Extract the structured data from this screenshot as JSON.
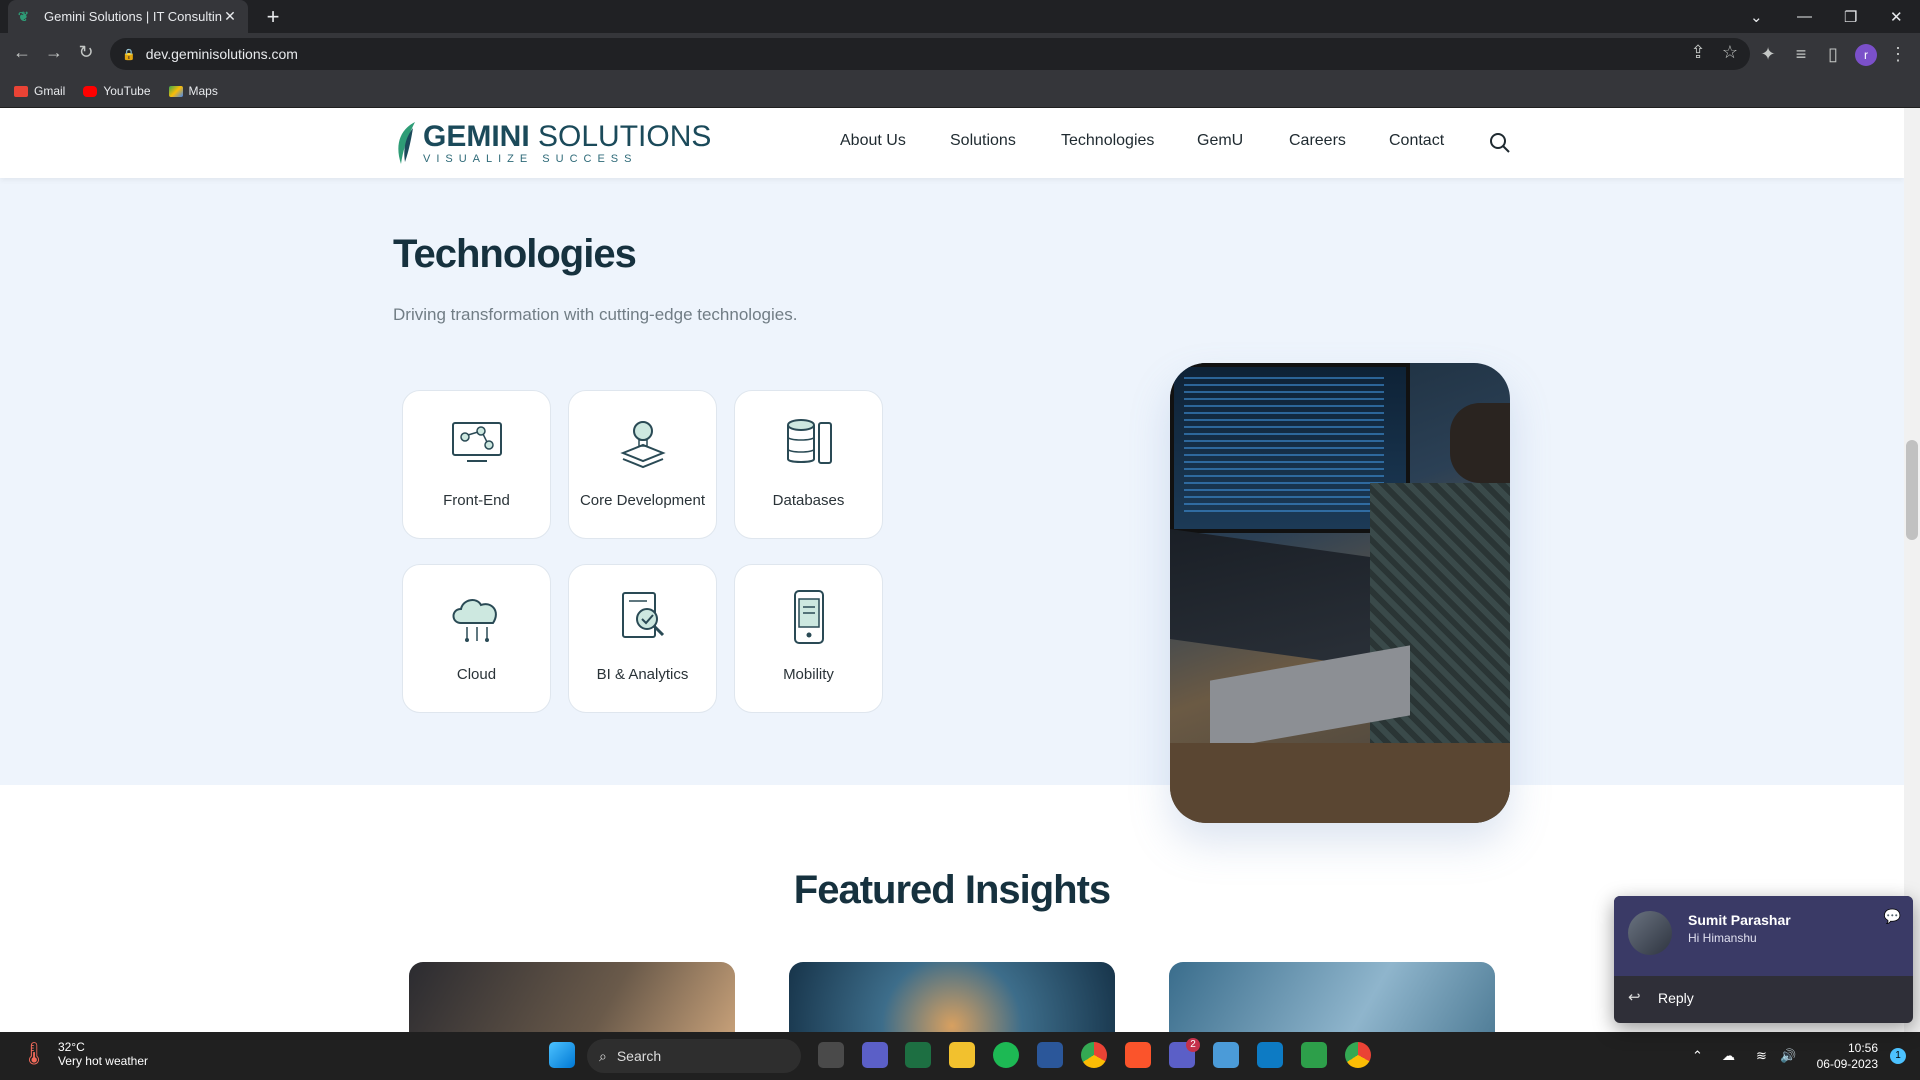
{
  "browser": {
    "tab_title": "Gemini Solutions | IT Consulting,",
    "url": "dev.geminisolutions.com",
    "bookmarks": [
      "Gmail",
      "YouTube",
      "Maps"
    ],
    "profile_initial": "r"
  },
  "site": {
    "logo_main_bold": "GEMINI",
    "logo_main_rest": " SOLUTIONS",
    "logo_tagline": "VISUALIZE SUCCESS",
    "menu": [
      "About Us",
      "Solutions",
      "Technologies",
      "GemU",
      "Careers",
      "Contact"
    ]
  },
  "technologies": {
    "title": "Technologies",
    "subtitle": "Driving transformation with cutting-edge technologies.",
    "cards": [
      {
        "label": "Front-End",
        "icon": "monitor-network-icon"
      },
      {
        "label": "Core Development",
        "icon": "lightbulb-stack-icon"
      },
      {
        "label": "Databases",
        "icon": "database-icon"
      },
      {
        "label": "Cloud",
        "icon": "cloud-icon"
      },
      {
        "label": "BI & Analytics",
        "icon": "report-magnifier-icon"
      },
      {
        "label": "Mobility",
        "icon": "mobile-phone-icon"
      }
    ]
  },
  "featured": {
    "title": "Featured Insights"
  },
  "notification": {
    "sender": "Sumit Parashar",
    "message": "Hi Himanshu",
    "reply_label": "Reply"
  },
  "taskbar": {
    "temperature": "32°C",
    "weather": "Very hot weather",
    "search_placeholder": "Search",
    "time": "10:56",
    "date": "06-09-2023",
    "teams_badge": "2",
    "notification_count": "1"
  },
  "colors": {
    "brand_dark": "#16313e",
    "section_bg": "#eef4fc",
    "accent_green": "#2e9c76"
  }
}
